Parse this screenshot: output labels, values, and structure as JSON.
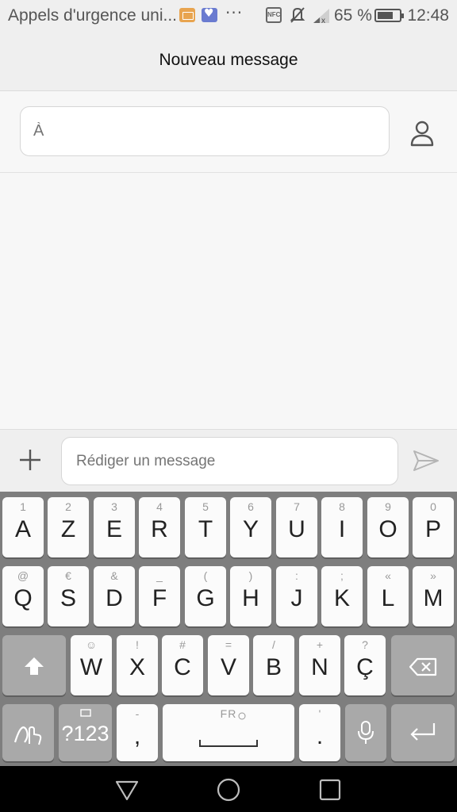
{
  "status_bar": {
    "carrier": "Appels d'urgence uni...",
    "icons": [
      "keyboard-icon",
      "health-app-icon",
      "more-notifications-icon",
      "nfc-icon",
      "mute-icon",
      "signal-icon",
      "battery-icon"
    ],
    "nfc": "NFC",
    "more": "···",
    "battery_percent": "65 %",
    "battery_level": 0.65,
    "time": "12:48"
  },
  "header": {
    "title": "Nouveau message"
  },
  "recipient": {
    "placeholder": "À",
    "icon": "contact-person-icon"
  },
  "compose": {
    "placeholder": "Rédiger un message",
    "attach_icon": "plus-icon",
    "send_icon": "send-icon"
  },
  "keyboard": {
    "row1": [
      {
        "main": "A",
        "alt": "1"
      },
      {
        "main": "Z",
        "alt": "2"
      },
      {
        "main": "E",
        "alt": "3"
      },
      {
        "main": "R",
        "alt": "4"
      },
      {
        "main": "T",
        "alt": "5"
      },
      {
        "main": "Y",
        "alt": "6"
      },
      {
        "main": "U",
        "alt": "7"
      },
      {
        "main": "I",
        "alt": "8"
      },
      {
        "main": "O",
        "alt": "9"
      },
      {
        "main": "P",
        "alt": "0"
      }
    ],
    "row2": [
      {
        "main": "Q",
        "alt": "@"
      },
      {
        "main": "S",
        "alt": "€"
      },
      {
        "main": "D",
        "alt": "&"
      },
      {
        "main": "F",
        "alt": "_"
      },
      {
        "main": "G",
        "alt": "("
      },
      {
        "main": "H",
        "alt": ")"
      },
      {
        "main": "J",
        "alt": ":"
      },
      {
        "main": "K",
        "alt": ";"
      },
      {
        "main": "L",
        "alt": "«"
      },
      {
        "main": "M",
        "alt": "»"
      }
    ],
    "row3": [
      {
        "main": "W",
        "alt": "☺"
      },
      {
        "main": "X",
        "alt": "!"
      },
      {
        "main": "C",
        "alt": "#"
      },
      {
        "main": "V",
        "alt": "="
      },
      {
        "main": "B",
        "alt": "/"
      },
      {
        "main": "N",
        "alt": "+"
      },
      {
        "main": "Ç",
        "alt": "?"
      }
    ],
    "symbols_label": "?123",
    "comma": {
      "main": ",",
      "alt": "-"
    },
    "space_label": "FR",
    "period": {
      "main": ".",
      "alt": "'"
    }
  },
  "navigation": {
    "icons": [
      "back-icon",
      "home-icon",
      "recents-icon"
    ]
  }
}
